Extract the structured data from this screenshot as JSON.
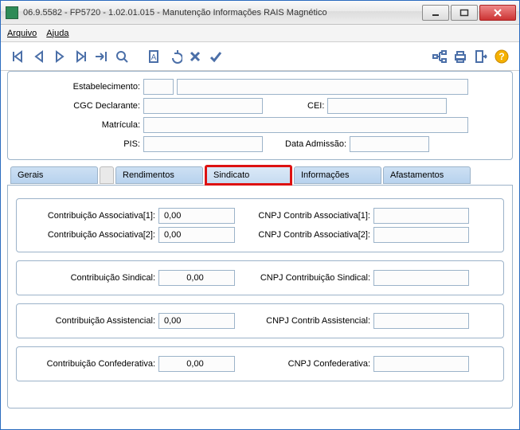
{
  "window": {
    "title": "06.9.5582 - FP5720 - 1.02.01.015 - Manutenção Informações RAIS Magnético"
  },
  "menu": {
    "arquivo": "Arquivo",
    "ajuda": "Ajuda"
  },
  "labels": {
    "estabelecimento": "Estabelecimento:",
    "cgc": "CGC Declarante:",
    "cei": "CEI:",
    "matricula": "Matrícula:",
    "pis": "PIS:",
    "data_admissao": "Data Admissão:"
  },
  "tabs": {
    "gerais": "Gerais",
    "rendimentos": "Rendimentos",
    "sindicato": "Sindicato",
    "informacoes": "Informações",
    "afastamentos": "Afastamentos"
  },
  "sindicato": {
    "contrib_assoc1_label": "Contribuição Associativa[1]:",
    "contrib_assoc1_value": "0,00",
    "cnpj_assoc1_label": "CNPJ Contrib Associativa[1]:",
    "cnpj_assoc1_value": "",
    "contrib_assoc2_label": "Contribuição Associativa[2]:",
    "contrib_assoc2_value": "0,00",
    "cnpj_assoc2_label": "CNPJ Contrib Associativa[2]:",
    "cnpj_assoc2_value": "",
    "contrib_sindical_label": "Contribuição Sindical:",
    "contrib_sindical_value": "0,00",
    "cnpj_sindical_label": "CNPJ Contribuição Sindical:",
    "cnpj_sindical_value": "",
    "contrib_assist_label": "Contribuição Assistencial:",
    "contrib_assist_value": "0,00",
    "cnpj_assist_label": "CNPJ Contrib Assistencial:",
    "cnpj_assist_value": "",
    "contrib_confed_label": "Contribuição Confederativa:",
    "contrib_confed_value": "0,00",
    "cnpj_confed_label": "CNPJ Confederativa:",
    "cnpj_confed_value": ""
  }
}
